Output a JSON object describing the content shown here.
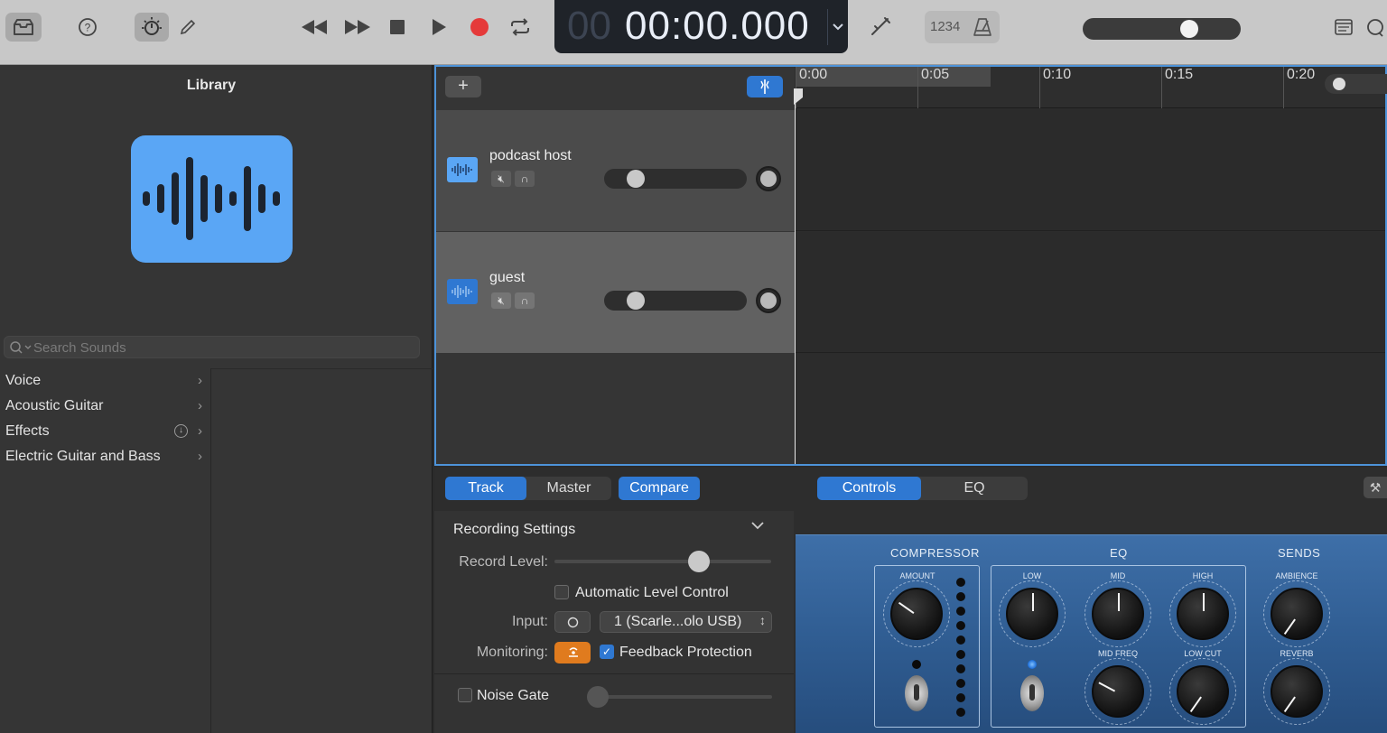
{
  "timecode": {
    "dim": "00",
    "value": "00:00.000"
  },
  "count_in": "1234",
  "library": {
    "title": "Library",
    "search_placeholder": "Search Sounds",
    "categories": [
      {
        "label": "Voice"
      },
      {
        "label": "Acoustic Guitar"
      },
      {
        "label": "Effects"
      },
      {
        "label": "Electric Guitar and Bass"
      }
    ]
  },
  "tracks": [
    {
      "name": "podcast host"
    },
    {
      "name": "guest"
    }
  ],
  "ruler": {
    "labels": [
      "0:00",
      "0:05",
      "0:10",
      "0:15",
      "0:20"
    ]
  },
  "tabs": {
    "track": "Track",
    "master": "Master",
    "compare": "Compare",
    "controls": "Controls",
    "eq": "EQ"
  },
  "recording": {
    "title": "Recording Settings",
    "record_level": "Record Level:",
    "alc": "Automatic Level Control",
    "input_label": "Input:",
    "input_value": "1 (Scarle...olo USB)",
    "monitoring_label": "Monitoring:",
    "feedback": "Feedback Protection",
    "noise_gate": "Noise Gate"
  },
  "plugin": {
    "compressor": "COMPRESSOR",
    "eq": "EQ",
    "sends": "SENDS",
    "amount": "AMOUNT",
    "low": "LOW",
    "mid": "MID",
    "high": "HIGH",
    "mid_freq": "MID FREQ",
    "low_cut": "LOW CUT",
    "ambience": "AMBIENCE",
    "reverb": "REVERB"
  },
  "colors": {
    "accent": "#2f78d2",
    "library_icon": "#5aa6f5",
    "record": "#e53a3a",
    "monitoring": "#e07b1e"
  }
}
